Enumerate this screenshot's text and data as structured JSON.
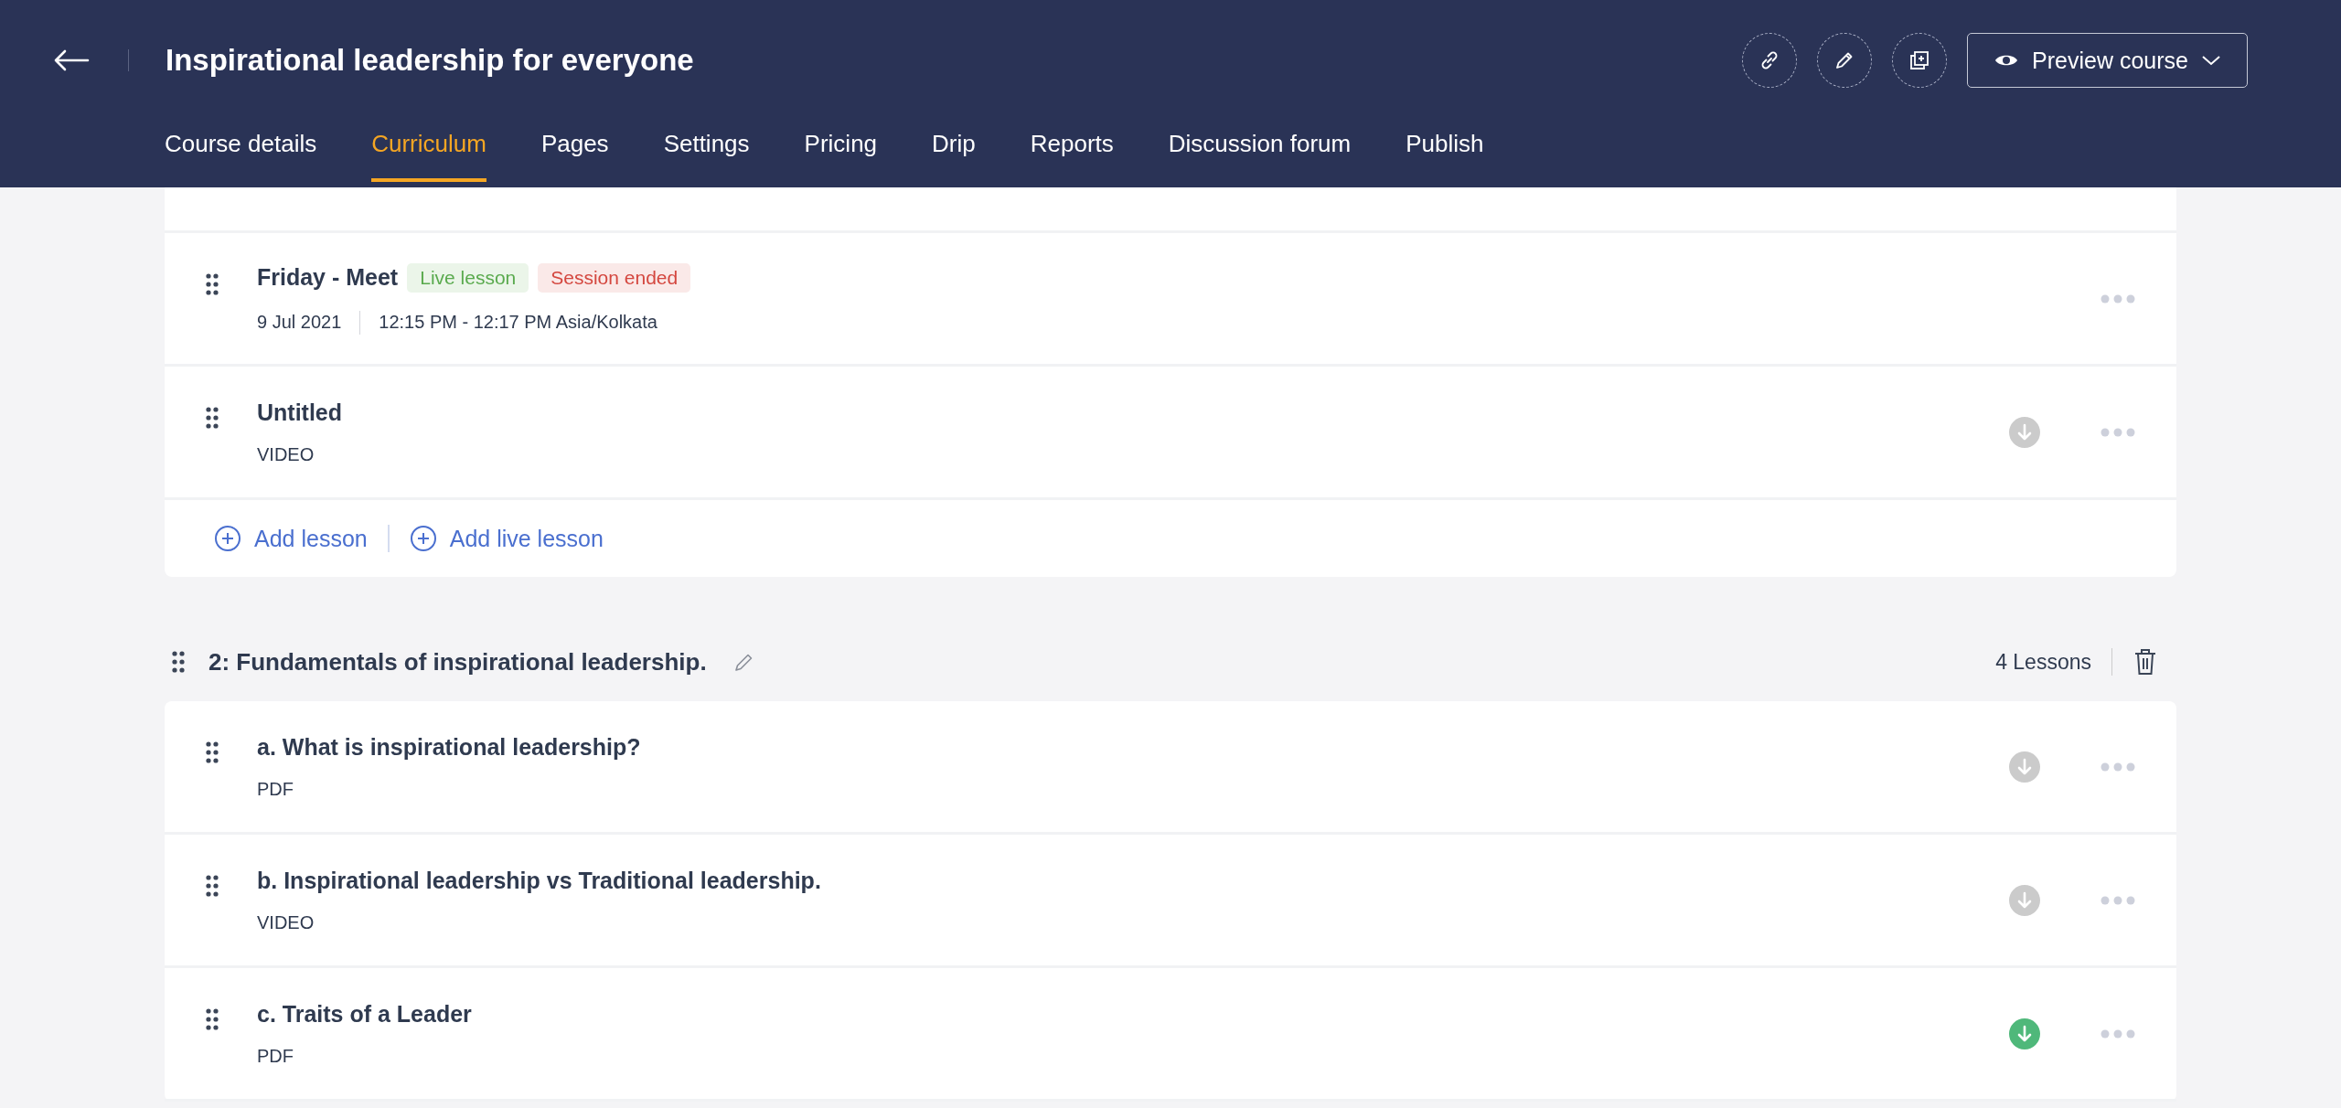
{
  "header": {
    "title": "Inspirational leadership for everyone",
    "preview_button": "Preview course"
  },
  "tabs": [
    {
      "label": "Course details",
      "selected": false
    },
    {
      "label": "Curriculum",
      "selected": true
    },
    {
      "label": "Pages",
      "selected": false
    },
    {
      "label": "Settings",
      "selected": false
    },
    {
      "label": "Pricing",
      "selected": false
    },
    {
      "label": "Drip",
      "selected": false
    },
    {
      "label": "Reports",
      "selected": false
    },
    {
      "label": "Discussion forum",
      "selected": false
    },
    {
      "label": "Publish",
      "selected": false
    }
  ],
  "sections": [
    {
      "lessons": [
        {
          "kind": "live",
          "title": "Friday - Meet",
          "tags": [
            {
              "label": "Live lesson",
              "color": "#5aaa4e"
            },
            {
              "label": "Session ended",
              "color": "#d4473f"
            }
          ],
          "date": "9 Jul 2021",
          "time": "12:15 PM - 12:17 PM Asia/Kolkata"
        },
        {
          "kind": "lesson",
          "title": "Untitled",
          "type": "VIDEO",
          "download_enabled": false
        }
      ],
      "actions": [
        "Add lesson",
        "Add live lesson"
      ]
    },
    {
      "title": "2: Fundamentals of inspirational leadership.",
      "count": "4 Lessons",
      "lessons": [
        {
          "kind": "lesson",
          "title": "a. What is inspirational leadership?",
          "type": "PDF",
          "download_enabled": false
        },
        {
          "kind": "lesson",
          "title": "b. Inspirational leadership vs Traditional leadership.",
          "type": "VIDEO",
          "download_enabled": false
        },
        {
          "kind": "lesson",
          "title": "c. Traits of a Leader",
          "type": "PDF",
          "download_enabled": true
        }
      ]
    }
  ]
}
